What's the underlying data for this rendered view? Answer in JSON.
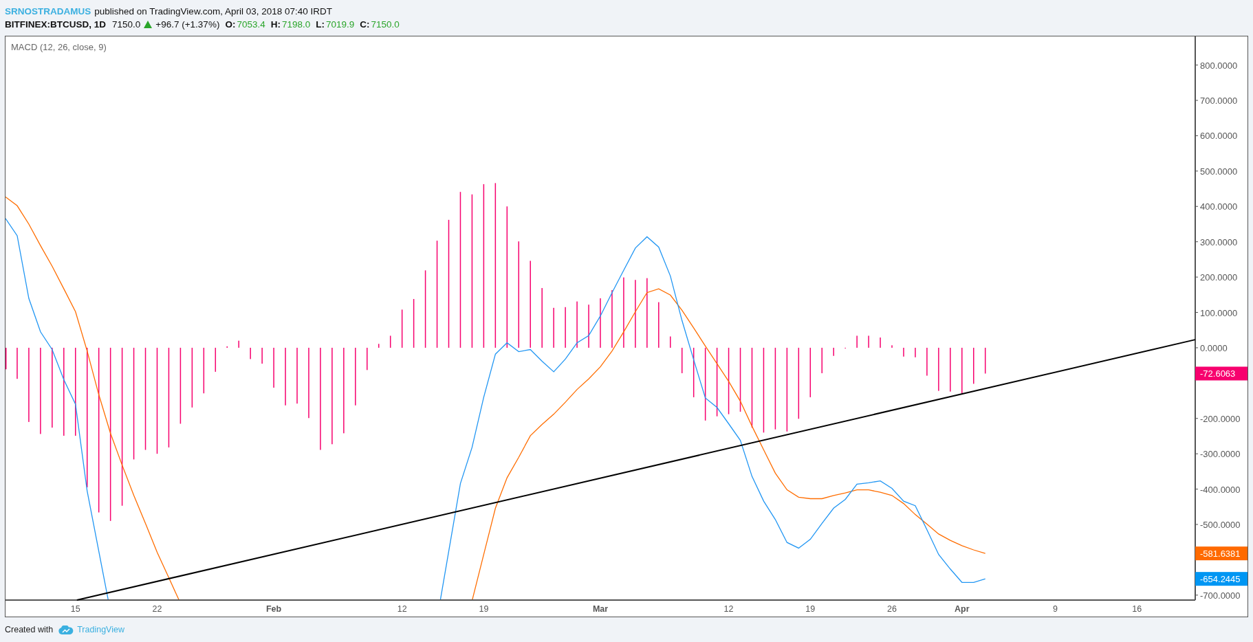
{
  "header": {
    "author": "SRNOSTRADAMUS",
    "published": "published on TradingView.com, April 03, 2018 07:40 IRDT"
  },
  "quote": {
    "symbol": "BITFINEX:BTCUSD, 1D",
    "last": "7150.0",
    "up": true,
    "change": "+96.7 (+1.37%)",
    "ohlc": [
      {
        "label": "O:",
        "value": "7053.4"
      },
      {
        "label": "H:",
        "value": "7198.0"
      },
      {
        "label": "L:",
        "value": "7019.9"
      },
      {
        "label": "C:",
        "value": "7150.0"
      }
    ]
  },
  "chart": {
    "title": "MACD (12, 26, close, 9)",
    "histogram": {
      "chart_data": {
        "type": "bar",
        "x": [
          "2018-01-09",
          "2018-01-10",
          "2018-01-11",
          "2018-01-12",
          "2018-01-13",
          "2018-01-14",
          "2018-01-15",
          "2018-01-16",
          "2018-01-17",
          "2018-01-18",
          "2018-01-19",
          "2018-01-20",
          "2018-01-21",
          "2018-01-22",
          "2018-01-23",
          "2018-01-24",
          "2018-01-25",
          "2018-01-26",
          "2018-01-27",
          "2018-01-28",
          "2018-01-29",
          "2018-01-30",
          "2018-01-31",
          "2018-02-01",
          "2018-02-02",
          "2018-02-03",
          "2018-02-04",
          "2018-02-05",
          "2018-02-06",
          "2018-02-07",
          "2018-02-08",
          "2018-02-09",
          "2018-02-10",
          "2018-02-11",
          "2018-02-12",
          "2018-02-13",
          "2018-02-14",
          "2018-02-15",
          "2018-02-16",
          "2018-02-17",
          "2018-02-18",
          "2018-02-19",
          "2018-02-20",
          "2018-02-21",
          "2018-02-22",
          "2018-02-23",
          "2018-02-24",
          "2018-02-25",
          "2018-02-26",
          "2018-02-27",
          "2018-02-28",
          "2018-03-01",
          "2018-03-02",
          "2018-03-03",
          "2018-03-04",
          "2018-03-05",
          "2018-03-06",
          "2018-03-07",
          "2018-03-08",
          "2018-03-09",
          "2018-03-10",
          "2018-03-11",
          "2018-03-12",
          "2018-03-13",
          "2018-03-14",
          "2018-03-15",
          "2018-03-16",
          "2018-03-17",
          "2018-03-18",
          "2018-03-19",
          "2018-03-20",
          "2018-03-21",
          "2018-03-22",
          "2018-03-23",
          "2018-03-24",
          "2018-03-25",
          "2018-03-26",
          "2018-03-27",
          "2018-03-28",
          "2018-03-29",
          "2018-03-30",
          "2018-03-31",
          "2018-04-01",
          "2018-04-02",
          "2018-04-03"
        ],
        "series": [
          {
            "color": "#f7006e",
            "values": [
              -61,
              -88,
              -210,
              -244,
              -226,
              -249,
              -249,
              -395,
              -466,
              -490,
              -447,
              -316,
              -289,
              -300,
              -282,
              -215,
              -169,
              -129,
              -68,
              4,
              20,
              -32,
              -45,
              -113,
              -163,
              -158,
              -199,
              -289,
              -273,
              -242,
              -163,
              -63,
              11,
              34,
              108,
              138,
              219,
              303,
              362,
              441,
              434,
              463,
              466,
              400,
              301,
              246,
              169,
              113,
              115,
              131,
              122,
              140,
              163,
              199,
              192,
              197,
              129,
              32,
              -72,
              -140,
              -206,
              -194,
              -188,
              -181,
              -226,
              -240,
              -231,
              -237,
              -201,
              -140,
              -72,
              -23,
              -2,
              34,
              34,
              29,
              7,
              -25,
              -27,
              -79,
              -122,
              -124,
              -129,
              -102,
              -73
            ]
          }
        ],
        "xlim": [
          "2018-01-09",
          "2018-04-21"
        ],
        "ylim": [
          -714,
          881
        ],
        "xticks": [
          {
            "value": "2018-01-15",
            "label": "15"
          },
          {
            "value": "2018-01-22",
            "label": "22"
          },
          {
            "value": "2018-02-01",
            "label": "Feb"
          },
          {
            "value": "2018-02-12",
            "label": "12"
          },
          {
            "value": "2018-02-19",
            "label": "19"
          },
          {
            "value": "2018-03-01",
            "label": "Mar"
          },
          {
            "value": "2018-03-12",
            "label": "12"
          },
          {
            "value": "2018-03-19",
            "label": "19"
          },
          {
            "value": "2018-03-26",
            "label": "26"
          },
          {
            "value": "2018-04-01",
            "label": "Apr"
          },
          {
            "value": "2018-04-09",
            "label": "9"
          },
          {
            "value": "2018-04-16",
            "label": "16"
          }
        ],
        "yticks": [
          {
            "value": 800,
            "label": "800.0000"
          },
          {
            "value": 700,
            "label": "700.0000"
          },
          {
            "value": 600,
            "label": "600.0000"
          },
          {
            "value": 500,
            "label": "500.0000"
          },
          {
            "value": 400,
            "label": "400.0000"
          },
          {
            "value": 300,
            "label": "300.0000"
          },
          {
            "value": 200,
            "label": "200.0000"
          },
          {
            "value": 100,
            "label": "100.0000"
          },
          {
            "value": 0,
            "label": "0.0000"
          },
          {
            "value": -200,
            "label": "-200.0000"
          },
          {
            "value": -300,
            "label": "-300.0000"
          },
          {
            "value": -400,
            "label": "-400.0000"
          },
          {
            "value": -500,
            "label": "-500.0000"
          },
          {
            "value": -700,
            "label": "-700.0000"
          }
        ]
      }
    },
    "lines": {
      "chart_data": {
        "type": "line",
        "x": [
          "2018-01-09",
          "2018-01-10",
          "2018-01-11",
          "2018-01-12",
          "2018-01-13",
          "2018-01-14",
          "2018-01-15",
          "2018-01-16",
          "2018-01-17",
          "2018-01-18",
          "2018-01-19",
          "2018-01-20",
          "2018-01-21",
          "2018-01-22",
          "2018-01-23",
          "2018-01-24",
          "2018-01-25",
          "2018-01-26",
          "2018-01-27",
          "2018-01-28",
          "2018-01-29",
          "2018-01-30",
          "2018-01-31",
          "2018-02-01",
          "2018-02-02",
          "2018-02-03",
          "2018-02-04",
          "2018-02-05",
          "2018-02-06",
          "2018-02-07",
          "2018-02-08",
          "2018-02-09",
          "2018-02-10",
          "2018-02-11",
          "2018-02-12",
          "2018-02-13",
          "2018-02-14",
          "2018-02-15",
          "2018-02-16",
          "2018-02-17",
          "2018-02-18",
          "2018-02-19",
          "2018-02-20",
          "2018-02-21",
          "2018-02-22",
          "2018-02-23",
          "2018-02-24",
          "2018-02-25",
          "2018-02-26",
          "2018-02-27",
          "2018-02-28",
          "2018-03-01",
          "2018-03-02",
          "2018-03-03",
          "2018-03-04",
          "2018-03-05",
          "2018-03-06",
          "2018-03-07",
          "2018-03-08",
          "2018-03-09",
          "2018-03-10",
          "2018-03-11",
          "2018-03-12",
          "2018-03-13",
          "2018-03-14",
          "2018-03-15",
          "2018-03-16",
          "2018-03-17",
          "2018-03-18",
          "2018-03-19",
          "2018-03-20",
          "2018-03-21",
          "2018-03-22",
          "2018-03-23",
          "2018-03-24",
          "2018-03-25",
          "2018-03-26",
          "2018-03-27",
          "2018-03-28",
          "2018-03-29",
          "2018-03-30",
          "2018-03-31",
          "2018-04-01",
          "2018-04-02",
          "2018-04-03"
        ],
        "series": [
          {
            "color": "#ff6d00",
            "values": [
              427,
              402,
              350,
              289,
              231,
              167,
              102,
              -9,
              -133,
              -242,
              -332,
              -418,
              -497,
              -579,
              -651,
              null,
              null,
              null,
              null,
              null,
              null,
              null,
              null,
              null,
              null,
              null,
              null,
              null,
              null,
              null,
              null,
              null,
              null,
              null,
              null,
              null,
              null,
              null,
              null,
              null,
              null,
              -585,
              -454,
              -368,
              -310,
              -249,
              -217,
              -188,
              -154,
              -118,
              -88,
              -54,
              -9,
              45,
              102,
              156,
              167,
              149,
              106,
              56,
              5,
              -45,
              -95,
              -151,
              -222,
              -289,
              -355,
              -402,
              -423,
              -427,
              -427,
              -418,
              -411,
              -402,
              -402,
              -409,
              -418,
              -441,
              -472,
              -499,
              -527,
              -545,
              -560,
              -572,
              -582
            ]
          },
          {
            "color": "#2196f3",
            "values": [
              366,
              317,
              140,
              45,
              -5,
              -90,
              -160,
              -405,
              -576,
              null,
              null,
              null,
              null,
              null,
              null,
              null,
              null,
              null,
              null,
              null,
              null,
              null,
              null,
              null,
              null,
              null,
              null,
              null,
              null,
              null,
              null,
              null,
              null,
              null,
              null,
              null,
              null,
              null,
              -576,
              -384,
              -282,
              -140,
              -18,
              14,
              -11,
              -5,
              -38,
              -68,
              -32,
              14,
              34,
              90,
              156,
              219,
              282,
              314,
              285,
              203,
              77,
              -34,
              -142,
              -169,
              -215,
              -262,
              -364,
              -434,
              -486,
              -551,
              -567,
              -542,
              -497,
              -454,
              -429,
              -386,
              -382,
              -377,
              -398,
              -434,
              -447,
              -515,
              -585,
              -626,
              -664,
              -664,
              -654
            ]
          }
        ],
        "xlim": [
          "2018-01-09",
          "2018-04-21"
        ],
        "ylim": [
          -714,
          881
        ]
      }
    },
    "price_labels": [
      {
        "text": "-72.6063",
        "color": "#f7006e"
      },
      {
        "text": "-581.6381",
        "color": "#ff6a00"
      },
      {
        "text": "-654.2445",
        "color": "#0096f3"
      }
    ]
  },
  "footer": {
    "created": "Created with",
    "brand": "TradingView"
  }
}
